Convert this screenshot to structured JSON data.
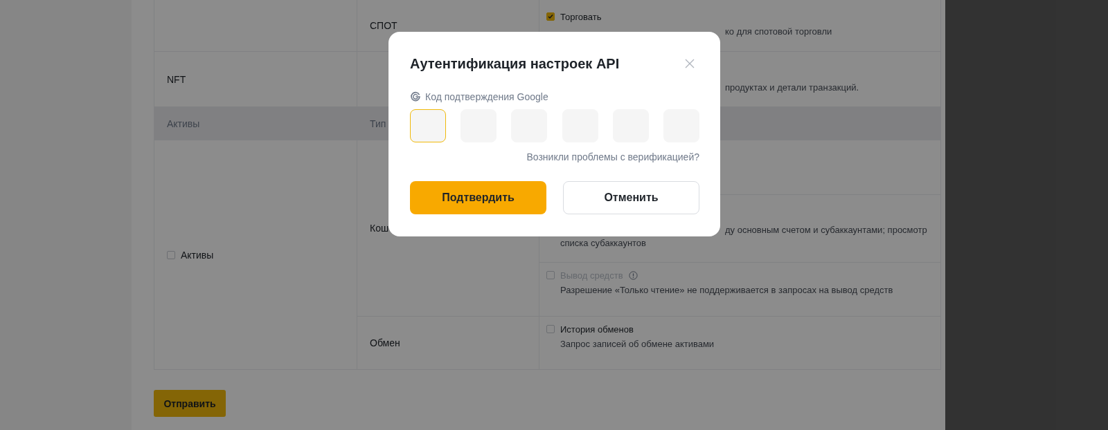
{
  "spot_row": {
    "type": "СПОТ",
    "permission": {
      "kind": "full",
      "label": "Торговать",
      "checked": true,
      "disabled": false,
      "info": false,
      "lines": [
        {
          "text": "ко для спотовой торговли",
          "covered": true
        }
      ]
    }
  },
  "nft_row": {
    "asset": "NFT",
    "lines": [
      {
        "text": "продуктах и детали транзакций.",
        "covered": true
      }
    ]
  },
  "columns": [
    "Активы",
    "Тип"
  ],
  "asset_group": {
    "label": "Активы",
    "checked": false,
    "types": [
      {
        "name": "Кош",
        "permissions": [
          {
            "kind": "covered"
          },
          {
            "kind": "fragment",
            "lines": [
              {
                "text": "ду основным счетом и субаккаунтами; просмотр",
                "covered": true
              },
              {
                "text": "списка субаккаунтов",
                "covered": false
              }
            ]
          },
          {
            "kind": "full",
            "label": "Вывод средств",
            "checked": false,
            "disabled": true,
            "info": true,
            "lines": [
              {
                "text": "Разрешение «Только чтение» не поддерживается в запросах на вывод средств",
                "covered": false
              }
            ]
          }
        ]
      },
      {
        "name": "Обмен",
        "permissions": [
          {
            "kind": "full",
            "label": "История обменов",
            "checked": false,
            "disabled": false,
            "info": false,
            "lines": [
              {
                "text": "Запрос записей об обмене активами",
                "covered": false
              }
            ]
          }
        ]
      }
    ]
  },
  "submit_button": "Отправить",
  "dialog": {
    "title": "Аутентификация настроек API",
    "code_label": "Код подтверждения Google",
    "code_inputs": [
      {
        "focused": true
      },
      {
        "focused": false
      },
      {
        "focused": false
      },
      {
        "focused": false
      },
      {
        "focused": false
      },
      {
        "focused": false
      }
    ],
    "help_link": "Возникли проблемы с верификацией?",
    "confirm_button": "Подтвердить",
    "cancel_button": "Отменить"
  }
}
